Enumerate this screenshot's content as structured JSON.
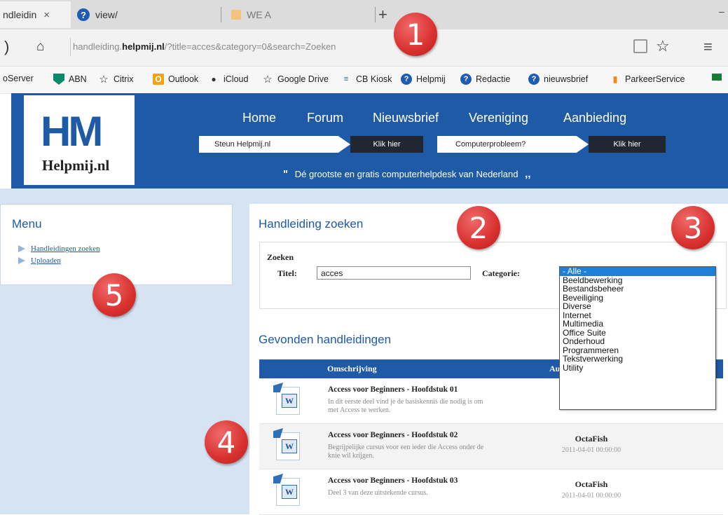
{
  "browser": {
    "tabs": [
      {
        "label": "ndleidin",
        "active": true
      },
      {
        "label": "view/",
        "icon": "helpmij-icon"
      },
      {
        "label": "WE A",
        "icon": "wordpress-icon"
      }
    ],
    "new_tab": "+",
    "close_glyph": "×",
    "url_prefix": "handleiding.",
    "url_domain": "helpmij.nl",
    "url_path": "/?title=acces&category=0&search=Zoeken",
    "favorites": [
      {
        "label": "oServer",
        "icon": ""
      },
      {
        "label": "ABN",
        "icon": "abn-shield-icon"
      },
      {
        "label": "Citrix",
        "icon": "star-icon"
      },
      {
        "label": "Outlook",
        "icon": "outlook-icon"
      },
      {
        "label": "iCloud",
        "icon": "apple-icon"
      },
      {
        "label": "Google Drive",
        "icon": "star-icon"
      },
      {
        "label": "CB Kiosk",
        "icon": "cb-icon"
      },
      {
        "label": "Helpmij",
        "icon": "helpmij-icon"
      },
      {
        "label": "Redactie",
        "icon": "helpmij-icon"
      },
      {
        "label": "nieuwsbrief",
        "icon": "helpmij-icon"
      },
      {
        "label": "ParkeerService",
        "icon": "parking-icon"
      }
    ]
  },
  "site": {
    "logo_text": "Helpmij.nl",
    "logo_letters": "HM",
    "nav": [
      "Home",
      "Forum",
      "Nieuwsbrief",
      "Vereniging",
      "Aanbieding"
    ],
    "ribbons": [
      {
        "label": "Steun Helpmij.nl",
        "action": "Klik hier"
      },
      {
        "label": "Computerprobleem?",
        "action": "Klik hier"
      }
    ],
    "slogan": "Dé grootste en gratis computerhelpdesk van Nederland",
    "quote_open": "\"",
    "quote_close": ",,"
  },
  "menu": {
    "title": "Menu",
    "items": [
      "Handleidingen zoeken",
      "Uploaden"
    ]
  },
  "search": {
    "title": "Handleiding zoeken",
    "legend": "Zoeken",
    "titel_label": "Titel:",
    "titel_value": "acces",
    "category_label": "Categorie:",
    "category_options": [
      "- Alle -",
      "Beeldbewerking",
      "Bestandsbeheer",
      "Beveiliging",
      "Diverse",
      "Internet",
      "Multimedia",
      "Office Suite",
      "Onderhoud",
      "Programmeren",
      "Tekstverwerking",
      "Utility"
    ],
    "selected_option": "- Alle -"
  },
  "results": {
    "title": "Gevonden handleidingen",
    "columns": [
      "Omschrijving",
      "Au"
    ],
    "rows": [
      {
        "title": "Access voor Beginners - Hoofdstuk 01",
        "desc": "In dit eerste deel vind je de basiskennis die nodig is om met Access te werken.",
        "author": "",
        "date": "20"
      },
      {
        "title": "Access voor Beginners - Hoofdstuk 02",
        "desc": "Begrijpelijke cursus voor een ieder die Access onder de knie wil krijgen.",
        "author": "OctaFish",
        "date": "2011-04-01 00:00:00"
      },
      {
        "title": "Access voor Beginners - Hoofdstuk 03",
        "desc": "Deel 3 van deze uitstekende cursus.",
        "author": "OctaFish",
        "date": "2011-04-01 00:00:00"
      }
    ]
  },
  "annotations": [
    "1",
    "2",
    "3",
    "4",
    "5"
  ],
  "colors": {
    "brand_blue": "#1e5aa6",
    "badge_red": "#d8312f",
    "content_bg": "#d5e3f2"
  }
}
